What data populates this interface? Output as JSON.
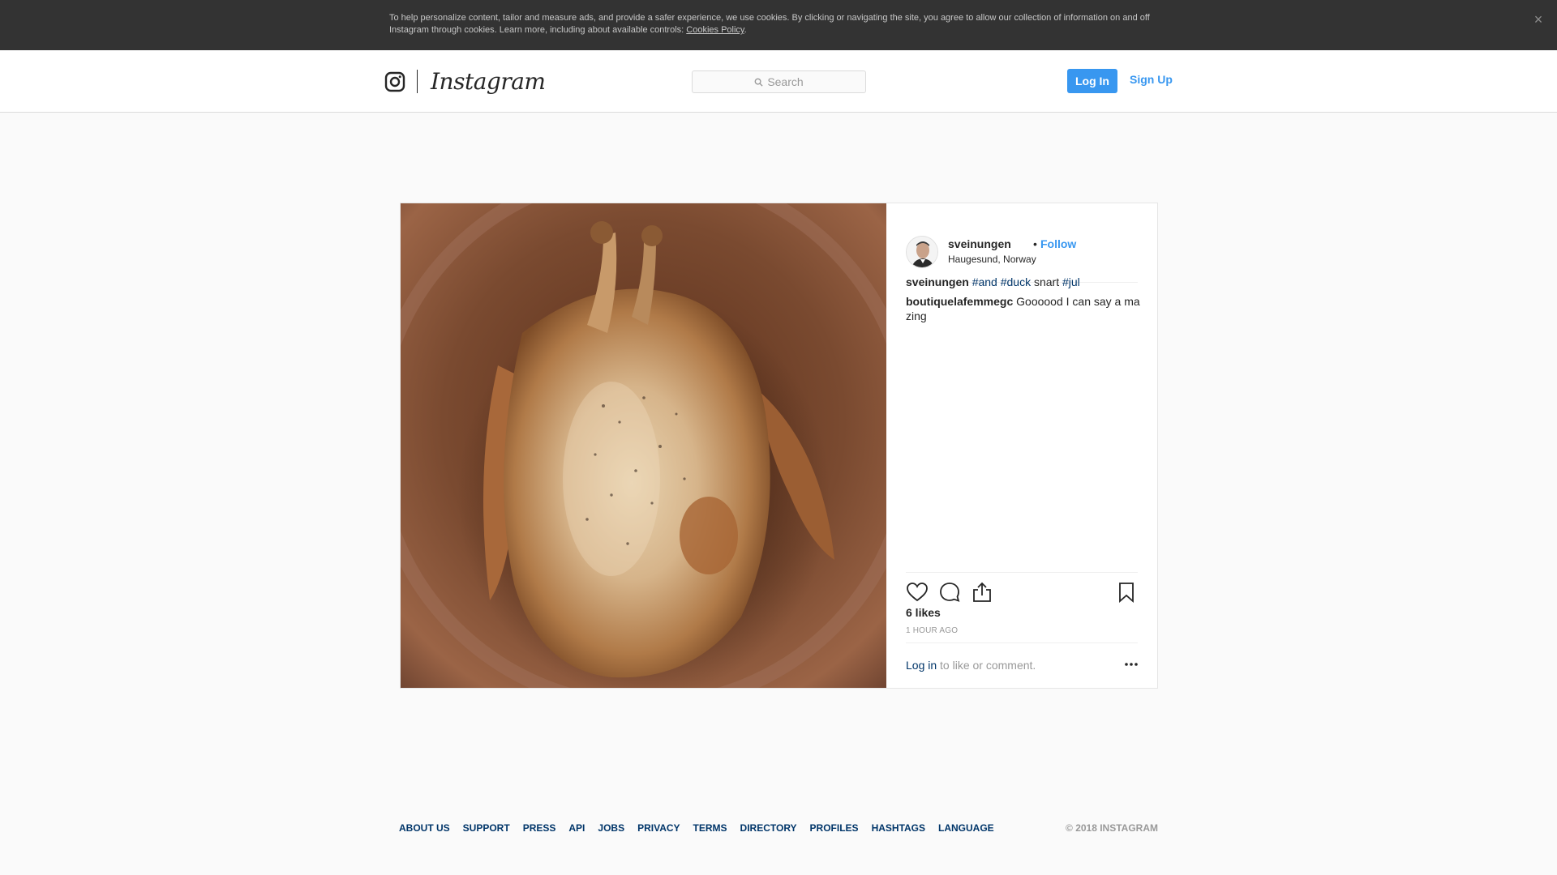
{
  "cookie_banner": {
    "text": "To help personalize content, tailor and measure ads, and provide a safer experience, we use cookies. By clicking or navigating the site, you agree to allow our collection of information on and off Instagram through cookies. Learn more, including about available controls: ",
    "policy_link": "Cookies Policy",
    "suffix": ".",
    "close_glyph": "×"
  },
  "header": {
    "logo_icon": "instagram-glyph-icon",
    "wordmark": "Instagram",
    "search_placeholder": "Search",
    "login_label": "Log In",
    "signup_label": "Sign Up"
  },
  "post": {
    "image_subject": "roast duck in a clay dish",
    "author": "sveinungen",
    "separator": "•",
    "follow_label": "Follow",
    "location": "Haugesund, Norway",
    "caption": {
      "user": "sveinungen",
      "tag1": "#and",
      "tag2": "#duck",
      "word": "snart",
      "tag3": "#jul"
    },
    "comment": {
      "user": "boutiquelafemmegc",
      "text": "Goooood  I can say a ma zing "
    },
    "likes": "6 likes",
    "time_ago": "1 HOUR AGO",
    "login_link": "Log in",
    "login_suffix": " to like or comment.",
    "more_glyph": "•••",
    "icons": [
      "heart-icon",
      "comment-icon",
      "share-icon",
      "bookmark-icon"
    ]
  },
  "footer": {
    "links": [
      "ABOUT US",
      "SUPPORT",
      "PRESS",
      "API",
      "JOBS",
      "PRIVACY",
      "TERMS",
      "DIRECTORY",
      "PROFILES",
      "HASHTAGS",
      "LANGUAGE"
    ],
    "copyright": "© 2018 INSTAGRAM"
  },
  "colors": {
    "accent": "#3897f0",
    "link_dark": "#003569",
    "banner_bg": "#333333"
  }
}
